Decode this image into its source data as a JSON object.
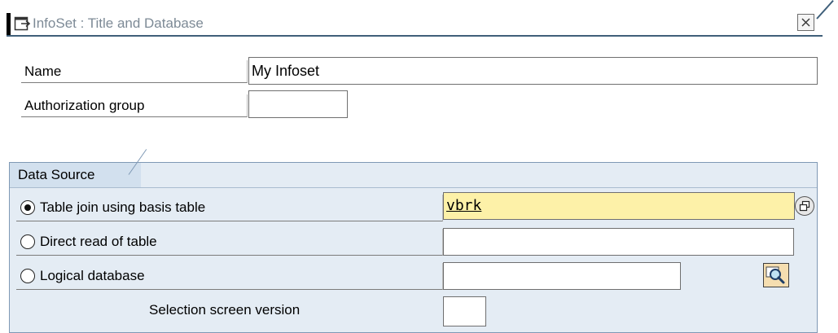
{
  "dialog": {
    "title": "InfoSet : Title and Database",
    "title_icon": "dialog-window-icon",
    "close_icon": "close-icon"
  },
  "header_fields": {
    "name_label": "Name",
    "name_value": "My Infoset",
    "auth_group_label": "Authorization group",
    "auth_group_value": ""
  },
  "data_source": {
    "group_title": "Data Source",
    "options": [
      {
        "label": "Table join using basis table",
        "selected": true,
        "value": "vbrk"
      },
      {
        "label": "Direct read of table",
        "selected": false,
        "value": ""
      },
      {
        "label": "Logical database",
        "selected": false,
        "value": ""
      }
    ],
    "selection_screen_version_label": "Selection screen version",
    "selection_screen_version_value": ""
  },
  "colors": {
    "group_background": "#e4ecf4",
    "group_border": "#7f99b5",
    "required_field": "#fdf1a8",
    "title_text": "#7d8a96"
  }
}
